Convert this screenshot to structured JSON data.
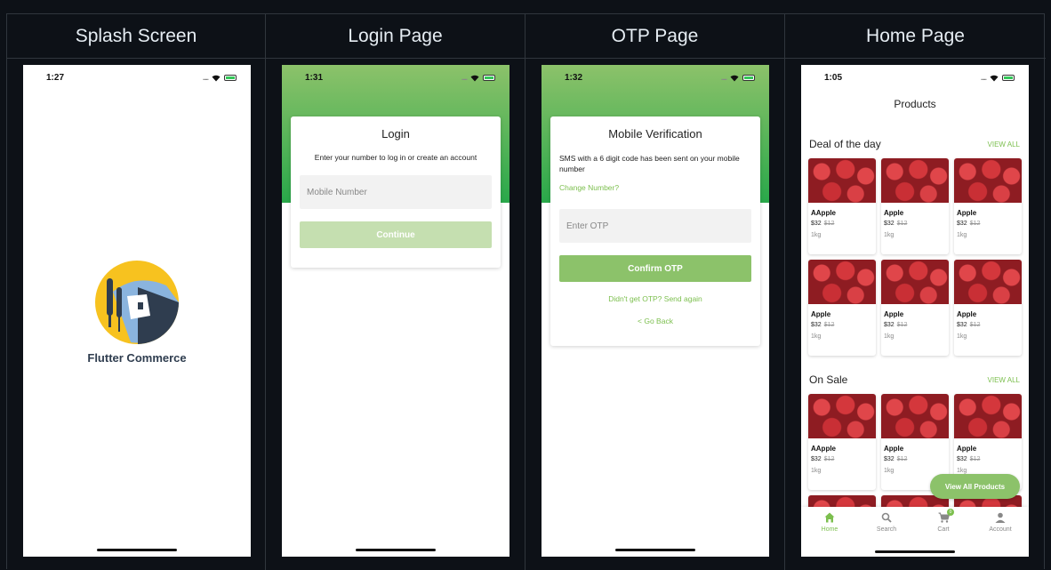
{
  "columns": [
    {
      "header": "Splash Screen"
    },
    {
      "header": "Login Page"
    },
    {
      "header": "OTP Page"
    },
    {
      "header": "Home Page"
    }
  ],
  "splash": {
    "time": "1:27",
    "logo_text": "Flutter Commerce"
  },
  "login": {
    "time": "1:31",
    "title": "Login",
    "subtitle": "Enter your number to log in or create an account",
    "mobile_placeholder": "Mobile Number",
    "continue_label": "Continue"
  },
  "otp": {
    "time": "1:32",
    "title": "Mobile Verification",
    "message": "SMS with a 6 digit code has been sent on your mobile number",
    "change_number": "Change Number?",
    "otp_placeholder": "Enter OTP",
    "confirm_label": "Confirm OTP",
    "resend": "Didn't get OTP? Send again",
    "go_back": "< Go Back"
  },
  "home": {
    "time": "1:05",
    "title": "Products",
    "deal_title": "Deal of the day",
    "sale_title": "On Sale",
    "view_all": "VIEW ALL",
    "deal_products": [
      {
        "name": "AApple",
        "price": "$32",
        "old_price": "$12",
        "unit": "1kg"
      },
      {
        "name": "Apple",
        "price": "$32",
        "old_price": "$12",
        "unit": "1kg"
      },
      {
        "name": "Apple",
        "price": "$32",
        "old_price": "$12",
        "unit": "1kg"
      },
      {
        "name": "Apple",
        "price": "$32",
        "old_price": "$12",
        "unit": "1kg"
      },
      {
        "name": "Apple",
        "price": "$32",
        "old_price": "$12",
        "unit": "1kg"
      },
      {
        "name": "Apple",
        "price": "$32",
        "old_price": "$12",
        "unit": "1kg"
      }
    ],
    "sale_products": [
      {
        "name": "AApple",
        "price": "$32",
        "old_price": "$12",
        "unit": "1kg"
      },
      {
        "name": "Apple",
        "price": "$32",
        "old_price": "$12",
        "unit": "1kg"
      },
      {
        "name": "Apple",
        "price": "$32",
        "old_price": "$12",
        "unit": "1kg"
      }
    ],
    "fab_label": "View All Products",
    "nav": [
      {
        "label": "Home",
        "icon": "home-icon"
      },
      {
        "label": "Search",
        "icon": "search-icon"
      },
      {
        "label": "Cart",
        "icon": "cart-icon",
        "badge": "0"
      },
      {
        "label": "Account",
        "icon": "account-icon"
      }
    ]
  },
  "colors": {
    "accent": "#8cc26a",
    "gradient_end": "#29a84a",
    "background": "#0d1117"
  }
}
